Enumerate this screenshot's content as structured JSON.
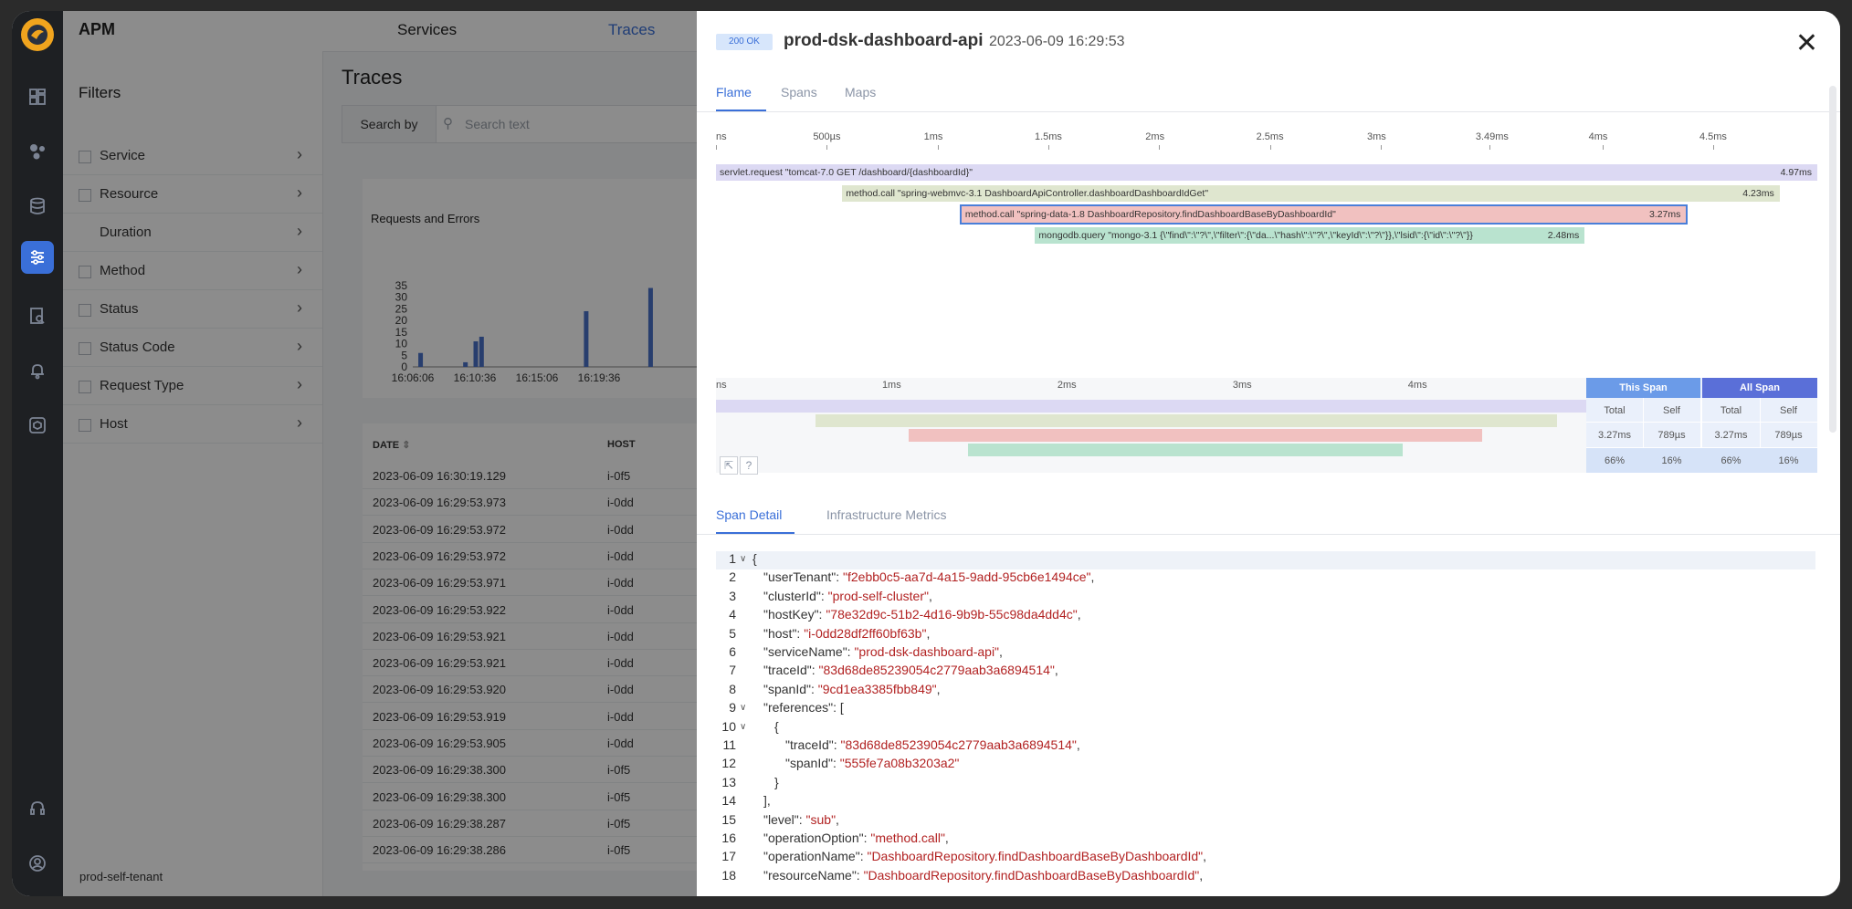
{
  "app": {
    "title": "APM",
    "nav": [
      "Services",
      "Traces"
    ],
    "tenant": "prod-self-tenant"
  },
  "filters": {
    "title": "Filters",
    "items": [
      {
        "label": "Service",
        "checkbox": true
      },
      {
        "label": "Resource",
        "checkbox": true
      },
      {
        "label": "Duration",
        "checkbox": false
      },
      {
        "label": "Method",
        "checkbox": true
      },
      {
        "label": "Status",
        "checkbox": true
      },
      {
        "label": "Status Code",
        "checkbox": true
      },
      {
        "label": "Request Type",
        "checkbox": true
      },
      {
        "label": "Host",
        "checkbox": true
      }
    ]
  },
  "traces": {
    "title": "Traces",
    "search_by": "Search by",
    "search_placeholder": "Search text",
    "requests_panel_title": "Requests and Errors",
    "table_headers": {
      "date": "DATE",
      "host": "HOST"
    },
    "rows": [
      {
        "date": "2023-06-09 16:30:19.129",
        "host": "i-0f5"
      },
      {
        "date": "2023-06-09 16:29:53.973",
        "host": "i-0dd"
      },
      {
        "date": "2023-06-09 16:29:53.972",
        "host": "i-0dd"
      },
      {
        "date": "2023-06-09 16:29:53.972",
        "host": "i-0dd"
      },
      {
        "date": "2023-06-09 16:29:53.971",
        "host": "i-0dd"
      },
      {
        "date": "2023-06-09 16:29:53.922",
        "host": "i-0dd"
      },
      {
        "date": "2023-06-09 16:29:53.921",
        "host": "i-0dd"
      },
      {
        "date": "2023-06-09 16:29:53.921",
        "host": "i-0dd"
      },
      {
        "date": "2023-06-09 16:29:53.920",
        "host": "i-0dd"
      },
      {
        "date": "2023-06-09 16:29:53.919",
        "host": "i-0dd"
      },
      {
        "date": "2023-06-09 16:29:53.905",
        "host": "i-0dd"
      },
      {
        "date": "2023-06-09 16:29:38.300",
        "host": "i-0f5"
      },
      {
        "date": "2023-06-09 16:29:38.300",
        "host": "i-0f5"
      },
      {
        "date": "2023-06-09 16:29:38.287",
        "host": "i-0f5"
      },
      {
        "date": "2023-06-09 16:29:38.286",
        "host": "i-0f5"
      }
    ]
  },
  "chart_data": {
    "type": "bar",
    "title": "Requests and Errors",
    "xlabel": "",
    "ylabel": "",
    "ylim": [
      0,
      35
    ],
    "yticks": [
      "35",
      "30",
      "25",
      "20",
      "15",
      "10",
      "5",
      "0"
    ],
    "xticks": [
      "16:06:06",
      "16:10:36",
      "16:15:06",
      "16:19:36"
    ],
    "categories": [
      "16:06:40",
      "16:09:55",
      "16:10:40",
      "16:11:05",
      "16:18:40",
      "16:23:20"
    ],
    "values": [
      6,
      2,
      11,
      13,
      24,
      34
    ]
  },
  "trace": {
    "status_badge": "200 OK",
    "service": "prod-dsk-dashboard-api",
    "timestamp": "2023-06-09 16:29:53",
    "tabs": [
      "Flame",
      "Spans",
      "Maps"
    ],
    "active_tab": "Flame",
    "timeline_ticks": [
      "ns",
      "500µs",
      "1ms",
      "1.5ms",
      "2ms",
      "2.5ms",
      "3ms",
      "3.49ms",
      "4ms",
      "4.5ms"
    ],
    "spans": [
      {
        "label": "servlet.request \"tomcat-7.0 GET /dashboard/{dashboardId}\"",
        "duration": "4.97ms",
        "start_ms": 0,
        "end_ms": 4.97,
        "color": "#dcd9f3"
      },
      {
        "label": "method.call \"spring-webmvc-3.1  DashboardApiController.dashboardDashboardIdGet\"",
        "duration": "4.23ms",
        "start_ms": 0.57,
        "end_ms": 4.8,
        "color": "#dfe6cf"
      },
      {
        "label": "method.call \"spring-data-1.8  DashboardRepository.findDashboardBaseByDashboardId\"",
        "duration": "3.27ms",
        "start_ms": 1.1,
        "end_ms": 4.37,
        "color": "#f1c1c0",
        "selected": true
      },
      {
        "label": "mongodb.query \"mongo-3.1  {\\\"find\\\":\\\"?\\\",\\\"filter\\\":{\\\"da...\\\"hash\\\":\\\"?\\\",\\\"keyId\\\":\\\"?\\\"}},\\\"lsid\\\":{\\\"id\\\":\\\"?\\\"}}",
        "duration": "2.48ms",
        "start_ms": 1.44,
        "end_ms": 3.92,
        "color": "#b9e3cf"
      }
    ],
    "minimap_ticks": [
      "ns",
      "1ms",
      "2ms",
      "3ms",
      "4ms"
    ],
    "stats": {
      "this_span": {
        "title": "This Span",
        "total_label": "Total",
        "self_label": "Self",
        "total": "3.27ms",
        "self": "789µs",
        "total_pct": "66%",
        "self_pct": "16%"
      },
      "all_span": {
        "title": "All Span",
        "total_label": "Total",
        "self_label": "Self",
        "total": "3.27ms",
        "self": "789µs",
        "total_pct": "66%",
        "self_pct": "16%"
      }
    },
    "detail_tabs": [
      "Span Detail",
      "Infrastructure Metrics"
    ],
    "json_lines": [
      {
        "n": "1",
        "fold": true,
        "indent": 0,
        "text": "{"
      },
      {
        "n": "2",
        "indent": 1,
        "key": "userTenant",
        "val": "\"f2ebb0c5-aa7d-4a15-9add-95cb6e1494ce\"",
        "tail": ","
      },
      {
        "n": "3",
        "indent": 1,
        "key": "clusterId",
        "val": "\"prod-self-cluster\"",
        "tail": ","
      },
      {
        "n": "4",
        "indent": 1,
        "key": "hostKey",
        "val": "\"78e32d9c-51b2-4d16-9b9b-55c98da4dd4c\"",
        "tail": ","
      },
      {
        "n": "5",
        "indent": 1,
        "key": "host",
        "val": "\"i-0dd28df2ff60bf63b\"",
        "tail": ","
      },
      {
        "n": "6",
        "indent": 1,
        "key": "serviceName",
        "val": "\"prod-dsk-dashboard-api\"",
        "tail": ","
      },
      {
        "n": "7",
        "indent": 1,
        "key": "traceId",
        "val": "\"83d68de85239054c2779aab3a6894514\"",
        "tail": ","
      },
      {
        "n": "8",
        "indent": 1,
        "key": "spanId",
        "val": "\"9cd1ea3385fbb849\"",
        "tail": ","
      },
      {
        "n": "9",
        "fold": true,
        "indent": 1,
        "key": "references",
        "val": "",
        "tail": "["
      },
      {
        "n": "10",
        "fold": true,
        "indent": 2,
        "text": "{"
      },
      {
        "n": "11",
        "indent": 3,
        "key": "traceId",
        "val": "\"83d68de85239054c2779aab3a6894514\"",
        "tail": ","
      },
      {
        "n": "12",
        "indent": 3,
        "key": "spanId",
        "val": "\"555fe7a08b3203a2\"",
        "tail": ""
      },
      {
        "n": "13",
        "indent": 2,
        "text": "}"
      },
      {
        "n": "14",
        "indent": 1,
        "text": "],"
      },
      {
        "n": "15",
        "indent": 1,
        "key": "level",
        "val": "\"sub\"",
        "tail": ","
      },
      {
        "n": "16",
        "indent": 1,
        "key": "operationOption",
        "val": "\"method.call\"",
        "tail": ","
      },
      {
        "n": "17",
        "indent": 1,
        "key": "operationName",
        "val": "\"DashboardRepository.findDashboardBaseByDashboardId\"",
        "tail": ","
      },
      {
        "n": "18",
        "indent": 1,
        "key": "resourceName",
        "val": "\"DashboardRepository.findDashboardBaseByDashboardId\"",
        "tail": ","
      }
    ]
  },
  "colors": {
    "accent": "#3a6fd8",
    "this_span_header": "#6b9be8",
    "all_span_header": "#5a6fd8"
  }
}
